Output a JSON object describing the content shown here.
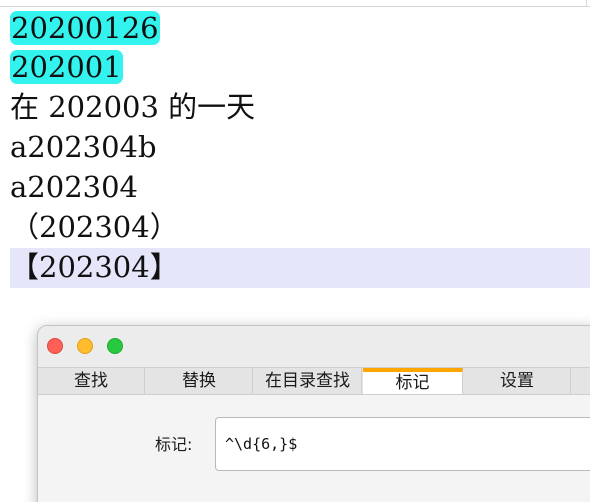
{
  "editor": {
    "lines": [
      {
        "text": "20200126"
      },
      {
        "text": "202001"
      },
      {
        "text": "在 202003 的一天"
      },
      {
        "text": "a202304b"
      },
      {
        "text": "a202304"
      },
      {
        "text": "（202304）"
      },
      {
        "text": "【202304】"
      }
    ]
  },
  "dialog": {
    "tabs": [
      {
        "label": "查找"
      },
      {
        "label": "替换"
      },
      {
        "label": "在目录查找"
      },
      {
        "label": "标记"
      },
      {
        "label": "设置"
      }
    ],
    "active_tab": "标记",
    "mark_label": "标记:",
    "mark_input_value": "^\\d{6,}$"
  },
  "colors": {
    "match_highlight": "#33f3ee",
    "current_line": "#e6e6fb",
    "active_tab_accent": "#ffa500",
    "close": "#fe5f57",
    "minimize": "#febc2e",
    "zoom": "#28c840"
  },
  "icons": [
    "close-window-icon",
    "minimize-window-icon",
    "zoom-window-icon"
  ]
}
